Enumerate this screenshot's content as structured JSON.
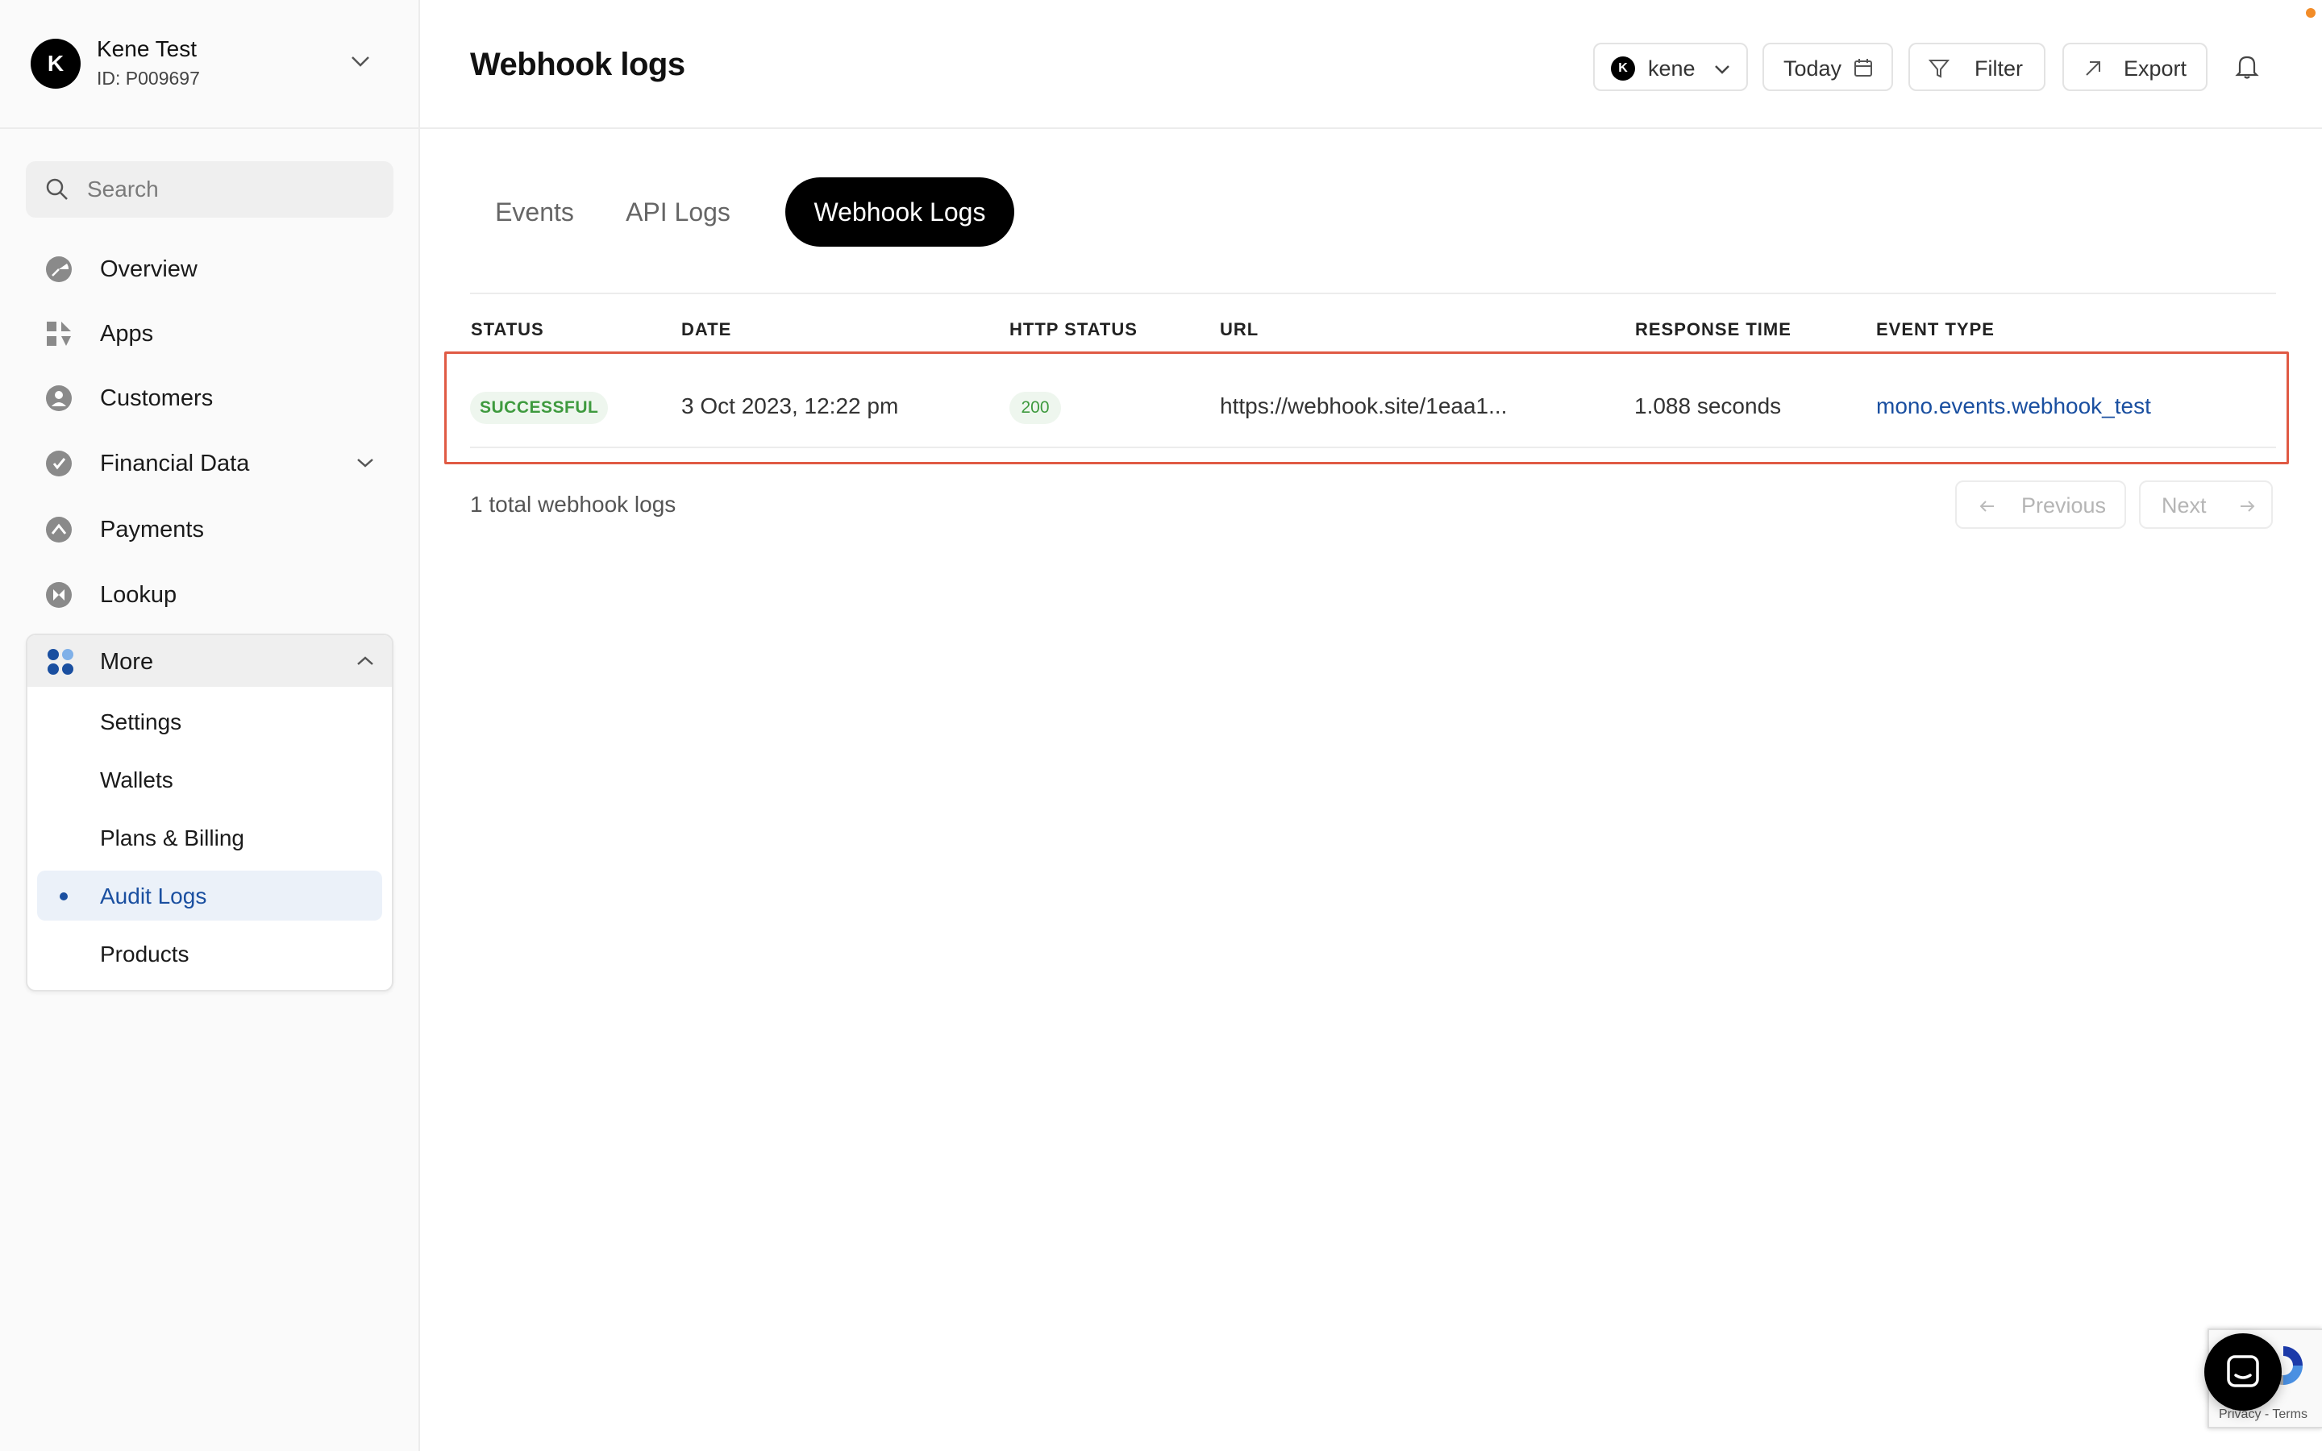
{
  "account": {
    "initial": "K",
    "name": "Kene Test",
    "id": "ID: P009697"
  },
  "search": {
    "placeholder": "Search"
  },
  "sidebar": {
    "items": [
      {
        "label": "Overview",
        "icon": "overview-icon"
      },
      {
        "label": "Apps",
        "icon": "apps-icon"
      },
      {
        "label": "Customers",
        "icon": "customers-icon"
      },
      {
        "label": "Financial Data",
        "icon": "financial-data-icon",
        "expandable": true
      },
      {
        "label": "Payments",
        "icon": "payments-icon"
      },
      {
        "label": "Lookup",
        "icon": "lookup-icon"
      }
    ],
    "more": {
      "label": "More",
      "icon": "grid-dots-icon",
      "expanded": true,
      "items": [
        {
          "label": "Settings",
          "active": false
        },
        {
          "label": "Wallets",
          "active": false
        },
        {
          "label": "Plans & Billing",
          "active": false
        },
        {
          "label": "Audit Logs",
          "active": true
        },
        {
          "label": "Products",
          "active": false
        }
      ]
    }
  },
  "header": {
    "title": "Webhook logs",
    "app_selector": {
      "initial": "K",
      "label": "kene"
    },
    "date_button": "Today",
    "filter_button": "Filter",
    "export_button": "Export"
  },
  "tabs": [
    {
      "label": "Events",
      "active": false
    },
    {
      "label": "API Logs",
      "active": false
    },
    {
      "label": "Webhook Logs",
      "active": true
    }
  ],
  "table": {
    "columns": [
      "STATUS",
      "DATE",
      "HTTP STATUS",
      "URL",
      "RESPONSE TIME",
      "EVENT TYPE"
    ],
    "rows": [
      {
        "status": "SUCCESSFUL",
        "date": "3 Oct 2023, 12:22 pm",
        "http_status": "200",
        "url": "https://webhook.site/1eaa1...",
        "response_time": "1.088 seconds",
        "event_type": "mono.events.webhook_test"
      }
    ]
  },
  "footer": {
    "total": "1 total webhook logs",
    "previous": "Previous",
    "next": "Next"
  },
  "recaptcha": {
    "terms": "Privacy - Terms"
  },
  "colors": {
    "accent": "#1a4fa0",
    "success": "#3e9a3e",
    "highlight_border": "#e05a44",
    "active_tab_bg": "#000000"
  }
}
